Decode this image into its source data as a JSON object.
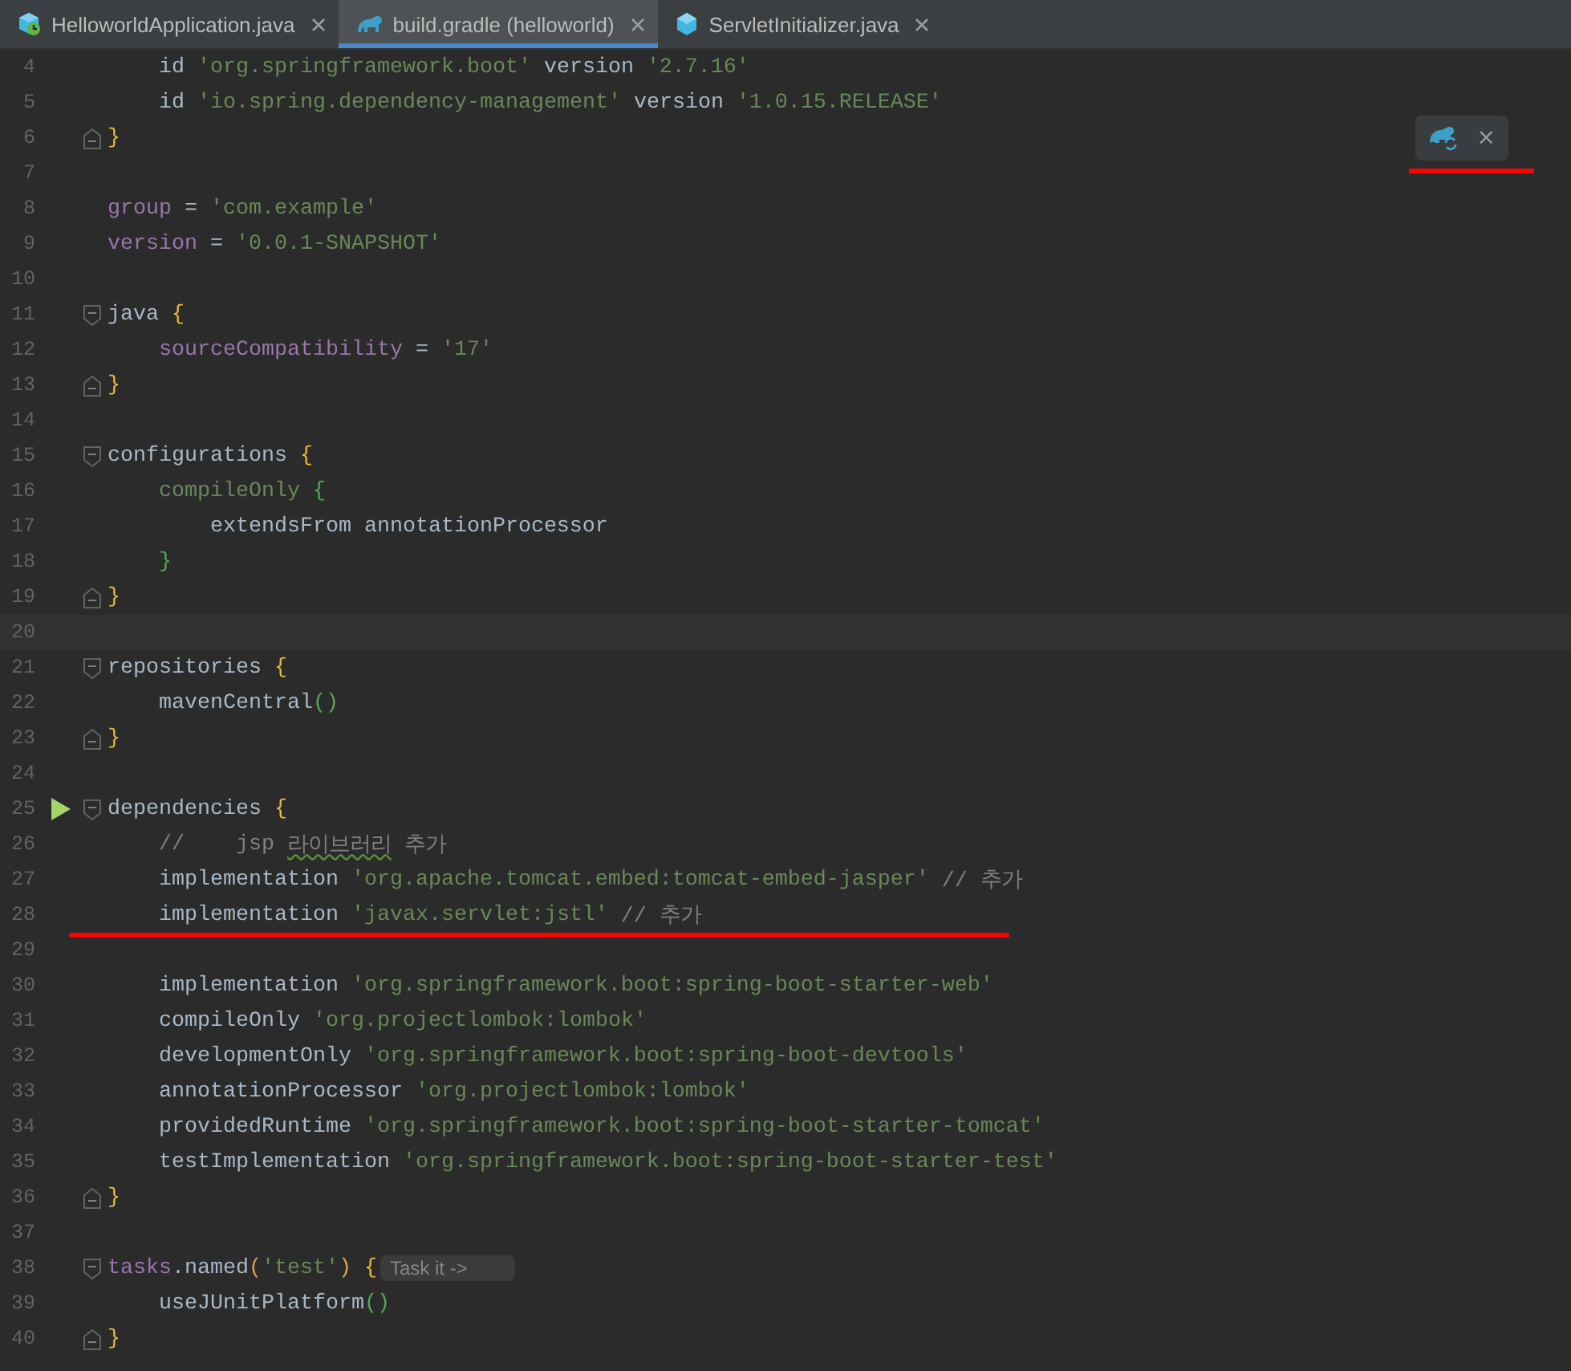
{
  "tabs": [
    {
      "label": "HelloworldApplication.java",
      "selected": false
    },
    {
      "label": "build.gradle (helloworld)",
      "selected": true
    },
    {
      "label": "ServletInitializer.java",
      "selected": false
    }
  ],
  "popup": {
    "close": "×",
    "underlined": true
  },
  "lines": [
    {
      "number": "4",
      "tokens": [
        {
          "kind": "plain",
          "text": "    id "
        },
        {
          "kind": "str",
          "text": "'org.springframework.boot'"
        },
        {
          "kind": "plain",
          "text": " version "
        },
        {
          "kind": "str",
          "text": "'2.7.16'"
        }
      ]
    },
    {
      "number": "5",
      "tokens": [
        {
          "kind": "plain",
          "text": "    id "
        },
        {
          "kind": "str",
          "text": "'io.spring.dependency-management'"
        },
        {
          "kind": "plain",
          "text": " version "
        },
        {
          "kind": "str",
          "text": "'1.0.15.RELEASE'"
        }
      ]
    },
    {
      "number": "6",
      "fold_end": true,
      "tokens": [
        {
          "kind": "brace",
          "text": "}"
        }
      ]
    },
    {
      "number": "7"
    },
    {
      "number": "8",
      "tokens": [
        {
          "kind": "prop",
          "text": "group"
        },
        {
          "kind": "plain",
          "text": " = "
        },
        {
          "kind": "str",
          "text": "'com.example'"
        }
      ]
    },
    {
      "number": "9",
      "tokens": [
        {
          "kind": "prop",
          "text": "version"
        },
        {
          "kind": "plain",
          "text": " = "
        },
        {
          "kind": "str",
          "text": "'0.0.1-SNAPSHOT'"
        }
      ]
    },
    {
      "number": "10"
    },
    {
      "number": "11",
      "fold_start": true,
      "tokens": [
        {
          "kind": "plain",
          "text": "java "
        },
        {
          "kind": "brace",
          "text": "{"
        }
      ]
    },
    {
      "number": "12",
      "tokens": [
        {
          "kind": "prop",
          "text": "    sourceCompatibility"
        },
        {
          "kind": "plain",
          "text": " = "
        },
        {
          "kind": "str",
          "text": "'17'"
        }
      ]
    },
    {
      "number": "13",
      "fold_end": true,
      "tokens": [
        {
          "kind": "brace",
          "text": "}"
        }
      ]
    },
    {
      "number": "14"
    },
    {
      "number": "15",
      "fold_start": true,
      "tokens": [
        {
          "kind": "plain",
          "text": "configurations "
        },
        {
          "kind": "brace",
          "text": "{"
        }
      ]
    },
    {
      "number": "16",
      "tokens": [
        {
          "kind": "str",
          "text": "    compileOnly "
        },
        {
          "kind": "brace2",
          "text": "{"
        }
      ]
    },
    {
      "number": "17",
      "tokens": [
        {
          "kind": "plain",
          "text": "        extendsFrom annotationProcessor"
        }
      ]
    },
    {
      "number": "18",
      "tokens": [
        {
          "kind": "brace2",
          "text": "    }"
        }
      ]
    },
    {
      "number": "19",
      "fold_end": true,
      "tokens": [
        {
          "kind": "brace",
          "text": "}"
        }
      ]
    },
    {
      "number": "20",
      "current": true
    },
    {
      "number": "21",
      "fold_start": true,
      "tokens": [
        {
          "kind": "plain",
          "text": "repositories "
        },
        {
          "kind": "brace",
          "text": "{"
        }
      ]
    },
    {
      "number": "22",
      "tokens": [
        {
          "kind": "plain",
          "text": "    mavenCentral"
        },
        {
          "kind": "brace2",
          "text": "()"
        }
      ]
    },
    {
      "number": "23",
      "fold_end": true,
      "tokens": [
        {
          "kind": "brace",
          "text": "}"
        }
      ]
    },
    {
      "number": "24"
    },
    {
      "number": "25",
      "fold_start": true,
      "run": true,
      "tokens": [
        {
          "kind": "plain",
          "text": "dependencies "
        },
        {
          "kind": "brace",
          "text": "{"
        }
      ]
    },
    {
      "number": "26",
      "tokens": [
        {
          "kind": "comment",
          "text": "    //    jsp "
        },
        {
          "kind": "typo",
          "text": "라이브러리"
        },
        {
          "kind": "comment",
          "text": " 추가"
        }
      ]
    },
    {
      "number": "27",
      "tokens": [
        {
          "kind": "plain",
          "text": "    implementation "
        },
        {
          "kind": "str",
          "text": "'org.apache.tomcat.embed:tomcat-embed-jasper'"
        },
        {
          "kind": "comment",
          "text": " // 추가"
        }
      ]
    },
    {
      "number": "28",
      "underlined": true,
      "tokens": [
        {
          "kind": "plain",
          "text": "    implementation "
        },
        {
          "kind": "str",
          "text": "'javax.servlet:jstl'"
        },
        {
          "kind": "comment",
          "text": " // 추가"
        }
      ]
    },
    {
      "number": "29"
    },
    {
      "number": "30",
      "tokens": [
        {
          "kind": "plain",
          "text": "    implementation "
        },
        {
          "kind": "str",
          "text": "'org.springframework.boot:spring-boot-starter-web'"
        }
      ]
    },
    {
      "number": "31",
      "tokens": [
        {
          "kind": "plain",
          "text": "    compileOnly "
        },
        {
          "kind": "str",
          "text": "'org.projectlombok:lombok'"
        }
      ]
    },
    {
      "number": "32",
      "tokens": [
        {
          "kind": "plain",
          "text": "    developmentOnly "
        },
        {
          "kind": "str",
          "text": "'org.springframework.boot:spring-boot-devtools'"
        }
      ]
    },
    {
      "number": "33",
      "tokens": [
        {
          "kind": "plain",
          "text": "    annotationProcessor "
        },
        {
          "kind": "str",
          "text": "'org.projectlombok:lombok'"
        }
      ]
    },
    {
      "number": "34",
      "tokens": [
        {
          "kind": "plain",
          "text": "    providedRuntime "
        },
        {
          "kind": "str",
          "text": "'org.springframework.boot:spring-boot-starter-tomcat'"
        }
      ]
    },
    {
      "number": "35",
      "tokens": [
        {
          "kind": "plain",
          "text": "    testImplementation "
        },
        {
          "kind": "str",
          "text": "'org.springframework.boot:spring-boot-starter-test'"
        }
      ]
    },
    {
      "number": "36",
      "fold_end": true,
      "tokens": [
        {
          "kind": "brace",
          "text": "}"
        }
      ]
    },
    {
      "number": "37"
    },
    {
      "number": "38",
      "fold_start": true,
      "tokens": [
        {
          "kind": "prop",
          "text": "tasks"
        },
        {
          "kind": "plain",
          "text": ".named"
        },
        {
          "kind": "paren",
          "text": "("
        },
        {
          "kind": "str",
          "text": "'test'"
        },
        {
          "kind": "paren",
          "text": ") "
        },
        {
          "kind": "brace",
          "text": "{"
        },
        {
          "kind": "hint",
          "text": "Task it ->"
        }
      ]
    },
    {
      "number": "39",
      "tokens": [
        {
          "kind": "plain",
          "text": "    useJUnitPlatform"
        },
        {
          "kind": "brace2",
          "text": "()"
        }
      ]
    },
    {
      "number": "40",
      "fold_end": true,
      "tokens": [
        {
          "kind": "brace",
          "text": "}"
        }
      ]
    }
  ]
}
